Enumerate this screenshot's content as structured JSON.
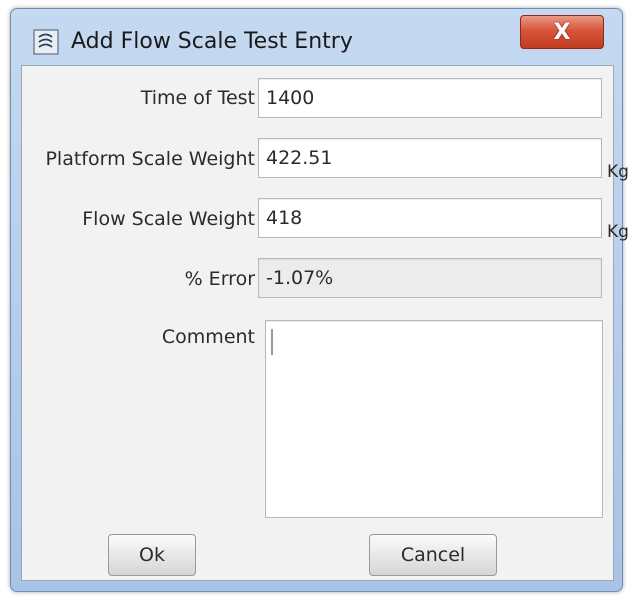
{
  "dialog": {
    "title": "Add Flow Scale Test Entry",
    "close_label": "X"
  },
  "form": {
    "time_of_test": {
      "label": "Time of Test",
      "value": "1400"
    },
    "platform_scale_weight": {
      "label": "Platform Scale Weight",
      "value": "422.51",
      "unit": "Kg"
    },
    "flow_scale_weight": {
      "label": "Flow Scale Weight",
      "value": "418",
      "unit": "Kg"
    },
    "percent_error": {
      "label": "% Error",
      "value": "-1.07%"
    },
    "comment": {
      "label": "Comment",
      "value": ""
    }
  },
  "buttons": {
    "ok": "Ok",
    "cancel": "Cancel"
  },
  "icons": {
    "app": "flow-scale-icon",
    "close": "close-icon"
  },
  "colors": {
    "title_bar": "#b7cde9",
    "close_button": "#d8553c",
    "client_background": "#f2f2f2"
  }
}
